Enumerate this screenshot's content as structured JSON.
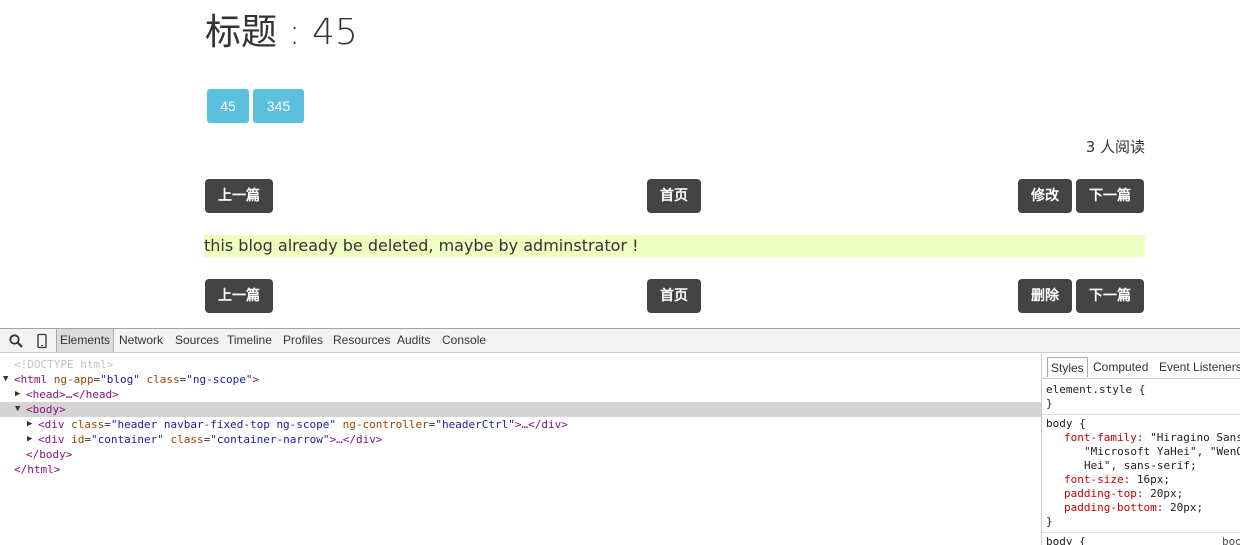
{
  "post": {
    "title": "标题 : 45",
    "tags": [
      "45",
      "345"
    ],
    "read_count": "3 人阅读",
    "notice": "this blog already be deleted, maybe by adminstrator !"
  },
  "nav_top": {
    "prev": "上一篇",
    "home": "首页",
    "edit": "修改",
    "next": "下一篇"
  },
  "nav_bottom": {
    "prev": "上一篇",
    "home": "首页",
    "delete": "删除",
    "next": "下一篇"
  },
  "colors": {
    "tag_bg": "#5bc0de",
    "btn_bg": "#444444",
    "notice_bg": "#eeffc0"
  },
  "devtools": {
    "tabs": [
      "Elements",
      "Network",
      "Sources",
      "Timeline",
      "Profiles",
      "Resources",
      "Audits",
      "Console"
    ],
    "active_tab": "Elements",
    "icons": [
      "search-icon",
      "device-mode-icon"
    ],
    "dom": {
      "doctype": "<!DOCTYPE html>",
      "html_open": {
        "tag": "<html",
        "attr1_name": "ng-app",
        "attr1_val": "\"blog\"",
        "attr2_name": "class",
        "attr2_val": "\"ng-scope\"",
        "close": ">"
      },
      "head": {
        "open": "<head>",
        "ellipsis": "…",
        "close": "</head>"
      },
      "body_open": "<body>",
      "div1": {
        "tag": "<div",
        "attr1_name": "class",
        "attr1_val": "\"header navbar-fixed-top ng-scope\"",
        "attr2_name": "ng-controller",
        "attr2_val": "\"headerCtrl\"",
        "rest": ">…</div>"
      },
      "div2": {
        "tag": "<div",
        "attr1_name": "id",
        "attr1_val": "\"container\"",
        "attr2_name": "class",
        "attr2_val": "\"container-narrow\"",
        "rest": ">…</div>"
      },
      "body_close": "</body>",
      "html_close": "</html>"
    },
    "styles_tabs": [
      "Styles",
      "Computed",
      "Event Listeners"
    ],
    "styles": {
      "element_style_open": "element.style {",
      "close_brace": "}",
      "body_selector": "body {",
      "ff_prop": "font-family:",
      "ff_val1": " \"Hiragino Sans",
      "ff_val2": "\"Microsoft YaHei\", \"WenQ",
      "ff_val3": "Hei\", sans-serif;",
      "fs_prop": "font-size:",
      "fs_val": " 16px;",
      "pt_prop": "padding-top:",
      "pt_val": " 20px;",
      "pb_prop": "padding-bottom:",
      "pb_val": " 20px;",
      "next_rule": "body {",
      "next_source": "boo"
    }
  }
}
